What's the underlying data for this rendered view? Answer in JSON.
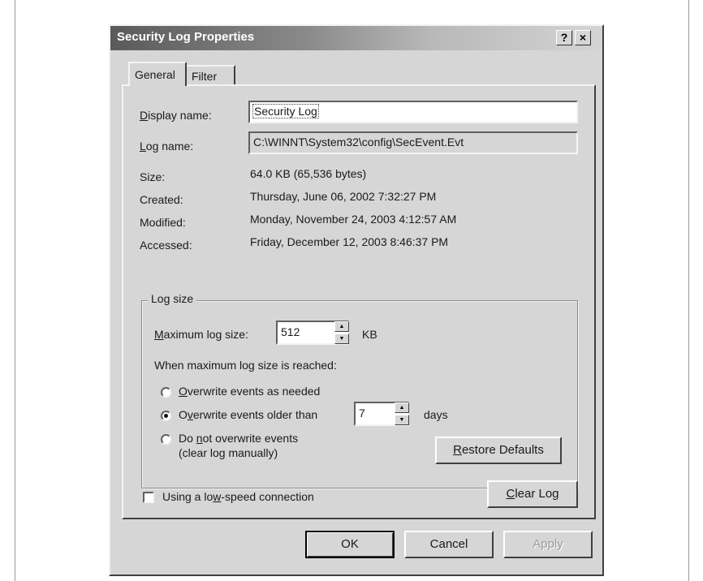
{
  "window": {
    "title": "Security Log Properties",
    "help_glyph": "?",
    "close_glyph": "×"
  },
  "tabs": [
    {
      "label": "General",
      "selected": true
    },
    {
      "label": "Filter",
      "selected": false
    }
  ],
  "general": {
    "display_name_label": "isplay name:",
    "display_name_label_u": "D",
    "display_name_value": "Security Log",
    "log_name_label": "og name:",
    "log_name_label_u": "L",
    "log_name_value": "C:\\WINNT\\System32\\config\\SecEvent.Evt",
    "info": [
      {
        "label": "Size:",
        "value": "64.0 KB (65,536 bytes)"
      },
      {
        "label": "Created:",
        "value": "Thursday, June 06, 2002 7:32:27 PM"
      },
      {
        "label": "Modified:",
        "value": "Monday, November 24, 2003 4:12:57 AM"
      },
      {
        "label": "Accessed:",
        "value": "Friday, December 12, 2003 8:46:37 PM"
      }
    ]
  },
  "log_size": {
    "group_label": "Log size",
    "max_size_label_u": "M",
    "max_size_label": "aximum log size:",
    "max_size_value": "512",
    "max_size_unit": "KB",
    "when_reached_label": "When maximum log size is reached:",
    "options": [
      {
        "u": "O",
        "label": "verwrite events as needed",
        "selected": false
      },
      {
        "u": "v",
        "pre": "O",
        "label": "erwrite events older than",
        "selected": true
      },
      {
        "pre": "Do ",
        "u": "n",
        "label": "ot overwrite events",
        "line2": "(clear log manually)",
        "selected": false
      }
    ],
    "days_value": "7",
    "days_unit": "days",
    "restore_button_u": "R",
    "restore_button": "estore Defaults"
  },
  "low_speed": {
    "label_pre": "Using a lo",
    "label_u": "w",
    "label_post": "-speed connection",
    "checked": false
  },
  "clear_log_button_u": "C",
  "clear_log_button": "lear Log",
  "footer": {
    "ok": "OK",
    "cancel": "Cancel",
    "apply": "Apply"
  }
}
